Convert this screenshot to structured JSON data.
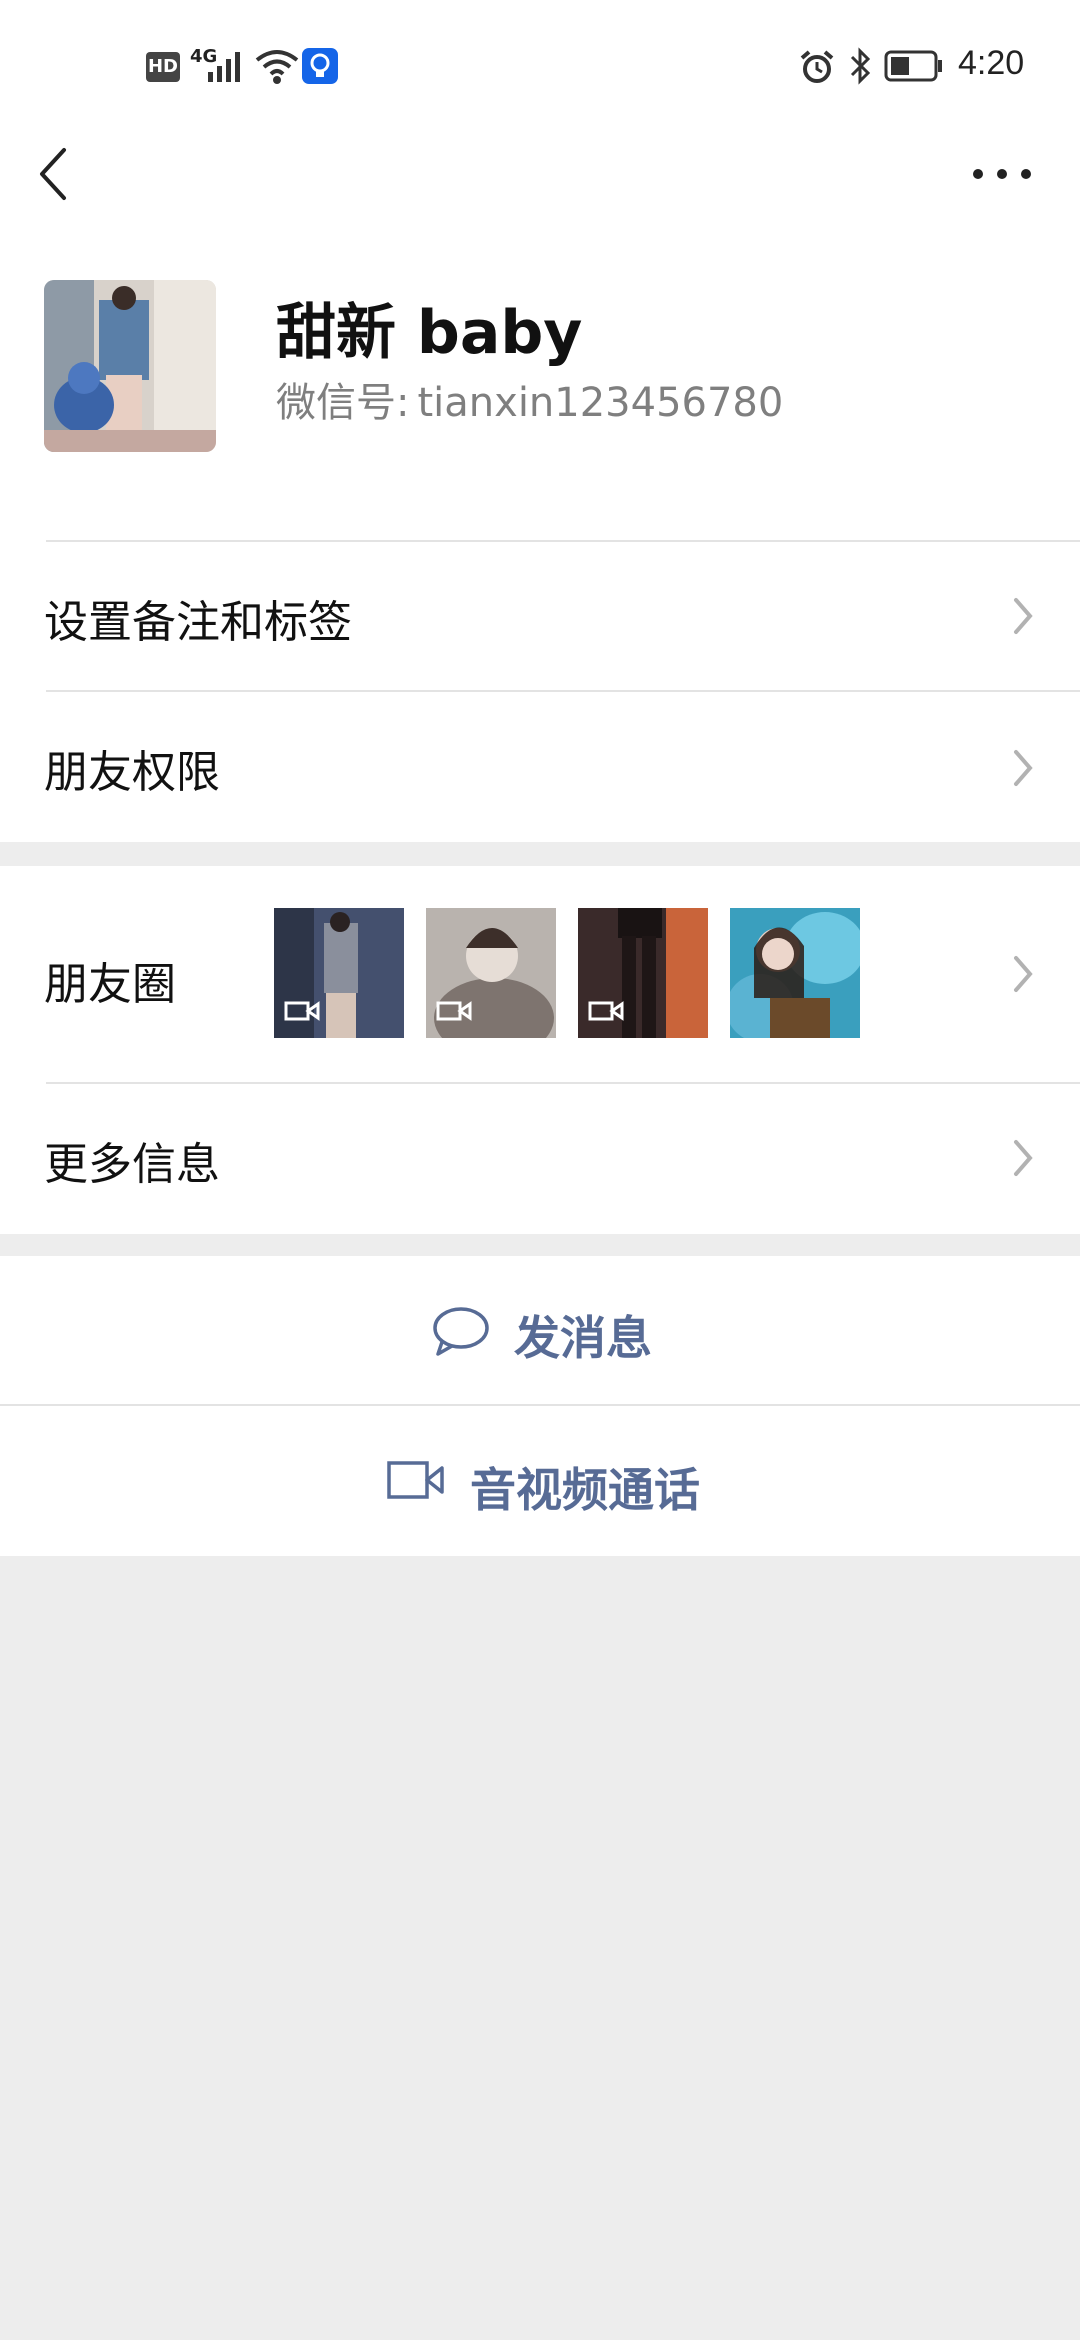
{
  "status_bar": {
    "hd": "HD",
    "network": "4G",
    "time": "4:20",
    "icons": [
      "hd-icon",
      "signal-icon",
      "wifi-icon",
      "bulb-icon",
      "alarm-icon",
      "bluetooth-icon",
      "battery-icon"
    ]
  },
  "profile": {
    "name": "甜新 baby",
    "wechat_id_label": "微信号:",
    "wechat_id": "tianxin123456780"
  },
  "rows": {
    "remark": "设置备注和标签",
    "permissions": "朋友权限",
    "moments": "朋友圈",
    "more_info": "更多信息"
  },
  "moments_thumbs": [
    {
      "type": "video",
      "colors": [
        "#44506e",
        "#2d3548",
        "#8a8f9c"
      ]
    },
    {
      "type": "video",
      "colors": [
        "#b9b3ae",
        "#7e746f",
        "#e6ddd6"
      ]
    },
    {
      "type": "video",
      "colors": [
        "#3a2a2a",
        "#c9643a",
        "#191313"
      ]
    },
    {
      "type": "image",
      "colors": [
        "#3a9fbe",
        "#6dc8e2",
        "#2b1b14"
      ]
    }
  ],
  "actions": {
    "send_message": "发消息",
    "call": "音视频通话"
  },
  "colors": {
    "link": "#576b95",
    "background": "#ededed",
    "card": "#ffffff",
    "divider": "#e3e3e3"
  }
}
